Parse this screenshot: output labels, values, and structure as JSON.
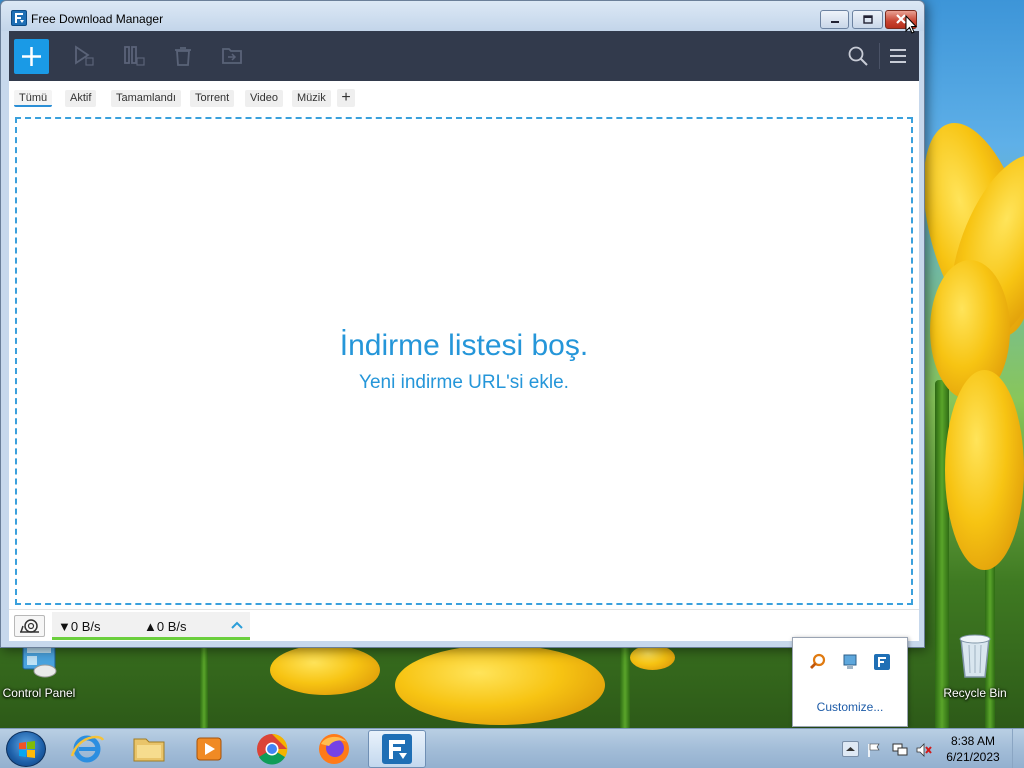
{
  "window": {
    "title": "Free Download Manager"
  },
  "toolbar": {
    "icons": [
      "add-download-icon",
      "resume-icon",
      "pause-icon",
      "delete-icon",
      "move-folder-icon",
      "search-icon",
      "menu-icon"
    ]
  },
  "tabs": [
    {
      "label": "Tümü",
      "active": true
    },
    {
      "label": "Aktif",
      "active": false
    },
    {
      "label": "Tamamlandı",
      "active": false
    },
    {
      "label": "Torrent",
      "active": false
    },
    {
      "label": "Video",
      "active": false
    },
    {
      "label": "Müzik",
      "active": false
    }
  ],
  "tab_add_label": "+",
  "empty_state": {
    "title": "İndirme listesi boş.",
    "subtitle": "Yeni indirme URL'si ekle."
  },
  "status": {
    "download_speed": "▼0 B/s",
    "upload_speed": "▲0 B/s"
  },
  "desktop": {
    "icons": [
      {
        "label": "Control Panel"
      },
      {
        "label": "Recycle Bin"
      }
    ]
  },
  "tray_popup": {
    "customize_label": "Customize..."
  },
  "taskbar": {
    "apps": [
      "internet-explorer-icon",
      "file-explorer-icon",
      "media-player-icon",
      "chrome-icon",
      "firefox-icon",
      "free-download-manager-icon"
    ],
    "time": "8:38 AM",
    "date": "6/21/2023"
  },
  "colors": {
    "accent": "#1a9ae6",
    "toolbar_bg": "#323a4c",
    "empty_text": "#2596d9",
    "speed_bar": "#6bcf3d"
  }
}
